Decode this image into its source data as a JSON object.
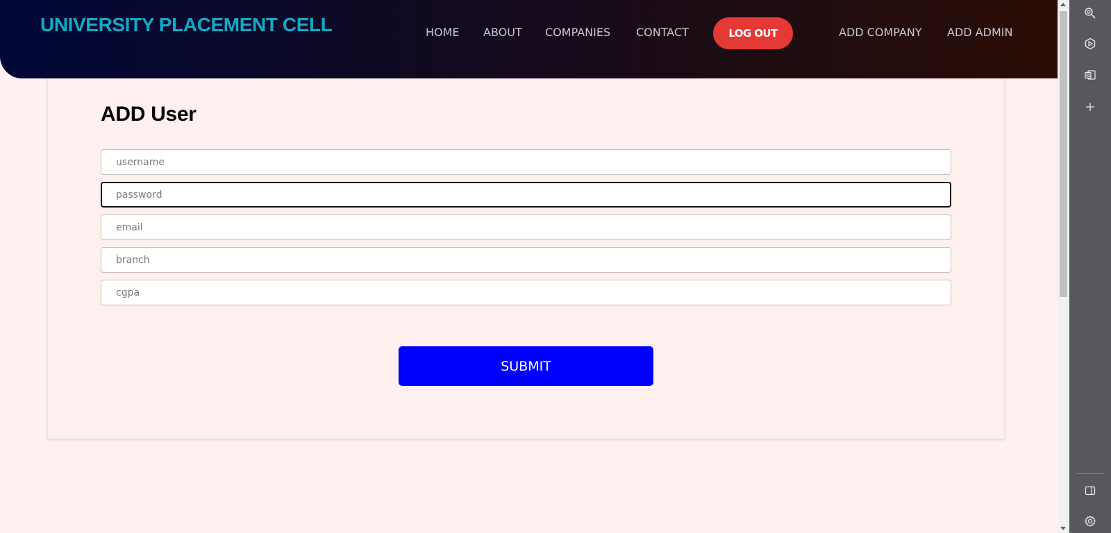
{
  "header": {
    "brand": "UNIVERSITY PLACEMENT CELL",
    "nav": {
      "home": "HOME",
      "about": "ABOUT",
      "companies": "COMPANIES",
      "contact": "CONTACT",
      "logout": "LOG OUT",
      "add_company": "ADD COMPANY",
      "add_admin": "ADD ADMIN"
    }
  },
  "form": {
    "title": "ADD User",
    "fields": [
      {
        "placeholder": "username",
        "value": ""
      },
      {
        "placeholder": "password",
        "value": ""
      },
      {
        "placeholder": "email",
        "value": ""
      },
      {
        "placeholder": "branch",
        "value": ""
      },
      {
        "placeholder": "cgpa",
        "value": ""
      }
    ],
    "submit_label": "SUBMIT"
  },
  "sidebar_icons": [
    "search-zoom-icon",
    "copilot-icon",
    "outlook-icon",
    "add-icon",
    "split-screen-icon",
    "settings-icon"
  ],
  "colors": {
    "brand": "#11aac6",
    "logout": "#e53935",
    "submit": "#0000ff",
    "page_bg": "#fff1f1"
  }
}
